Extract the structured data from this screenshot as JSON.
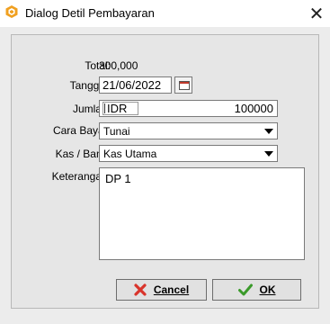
{
  "window": {
    "title": "Dialog Detil Pembayaran",
    "app_icon": "app-logo-icon",
    "close_icon": "close-icon"
  },
  "form": {
    "total_label": "Total:",
    "total_value": "300,000",
    "tanggal_label": "Tanggal:",
    "tanggal_value": "21/06/2022",
    "date_picker_icon": "calendar-icon",
    "jumlah_label": "Jumlah:",
    "currency": "IDR",
    "jumlah_value": "100000",
    "cara_bayar_label": "Cara Bayar:",
    "cara_bayar_value": "Tunai",
    "kas_bank_label": "Kas / Bank:",
    "kas_bank_value": "Kas Utama",
    "keterangan_label": "Keterangan:",
    "keterangan_value": "DP 1"
  },
  "buttons": {
    "cancel_label": "Cancel",
    "cancel_icon": "x-mark-icon",
    "cancel_color": "#d9342b",
    "ok_label": "OK",
    "ok_icon": "checkmark-icon",
    "ok_color": "#3a9a2a"
  }
}
